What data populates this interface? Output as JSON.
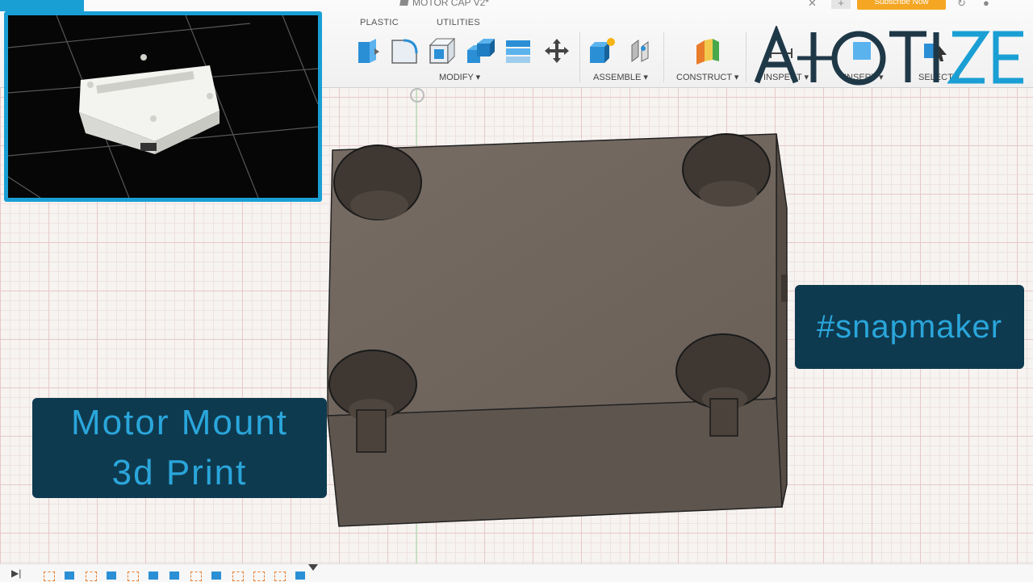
{
  "document": {
    "title": "MOTOR CAP V2*"
  },
  "toolbar": {
    "tabs": [
      {
        "label": "PLASTIC"
      },
      {
        "label": "UTILITIES"
      }
    ],
    "groups": [
      {
        "label": "MODIFY ▾"
      },
      {
        "label": "ASSEMBLE ▾"
      },
      {
        "label": "CONSTRUCT ▾"
      },
      {
        "label": "INSPECT ▾"
      },
      {
        "label": "INSERT ▾"
      },
      {
        "label": "SELECT ▾"
      }
    ],
    "subscribe_label": "Subscribe Now"
  },
  "overlay": {
    "logo_text": "AIOTIZE",
    "caption_main_line1": "Motor Mount",
    "caption_main_line2": "3d Print",
    "caption_tag": "#snapmaker"
  },
  "colors": {
    "accent": "#1a9fd4",
    "caption_bg": "#0e3a4f",
    "caption_text": "#2aa6db",
    "model_body": "#6b6159",
    "subscribe": "#f5a623"
  },
  "icons": [
    "press-pull-icon",
    "fillet-icon",
    "shell-icon",
    "combine-icon",
    "scale-icon",
    "move-icon",
    "new-component-icon",
    "joint-icon",
    "construct-plane-icon",
    "measure-icon",
    "insert-icon",
    "select-icon"
  ]
}
